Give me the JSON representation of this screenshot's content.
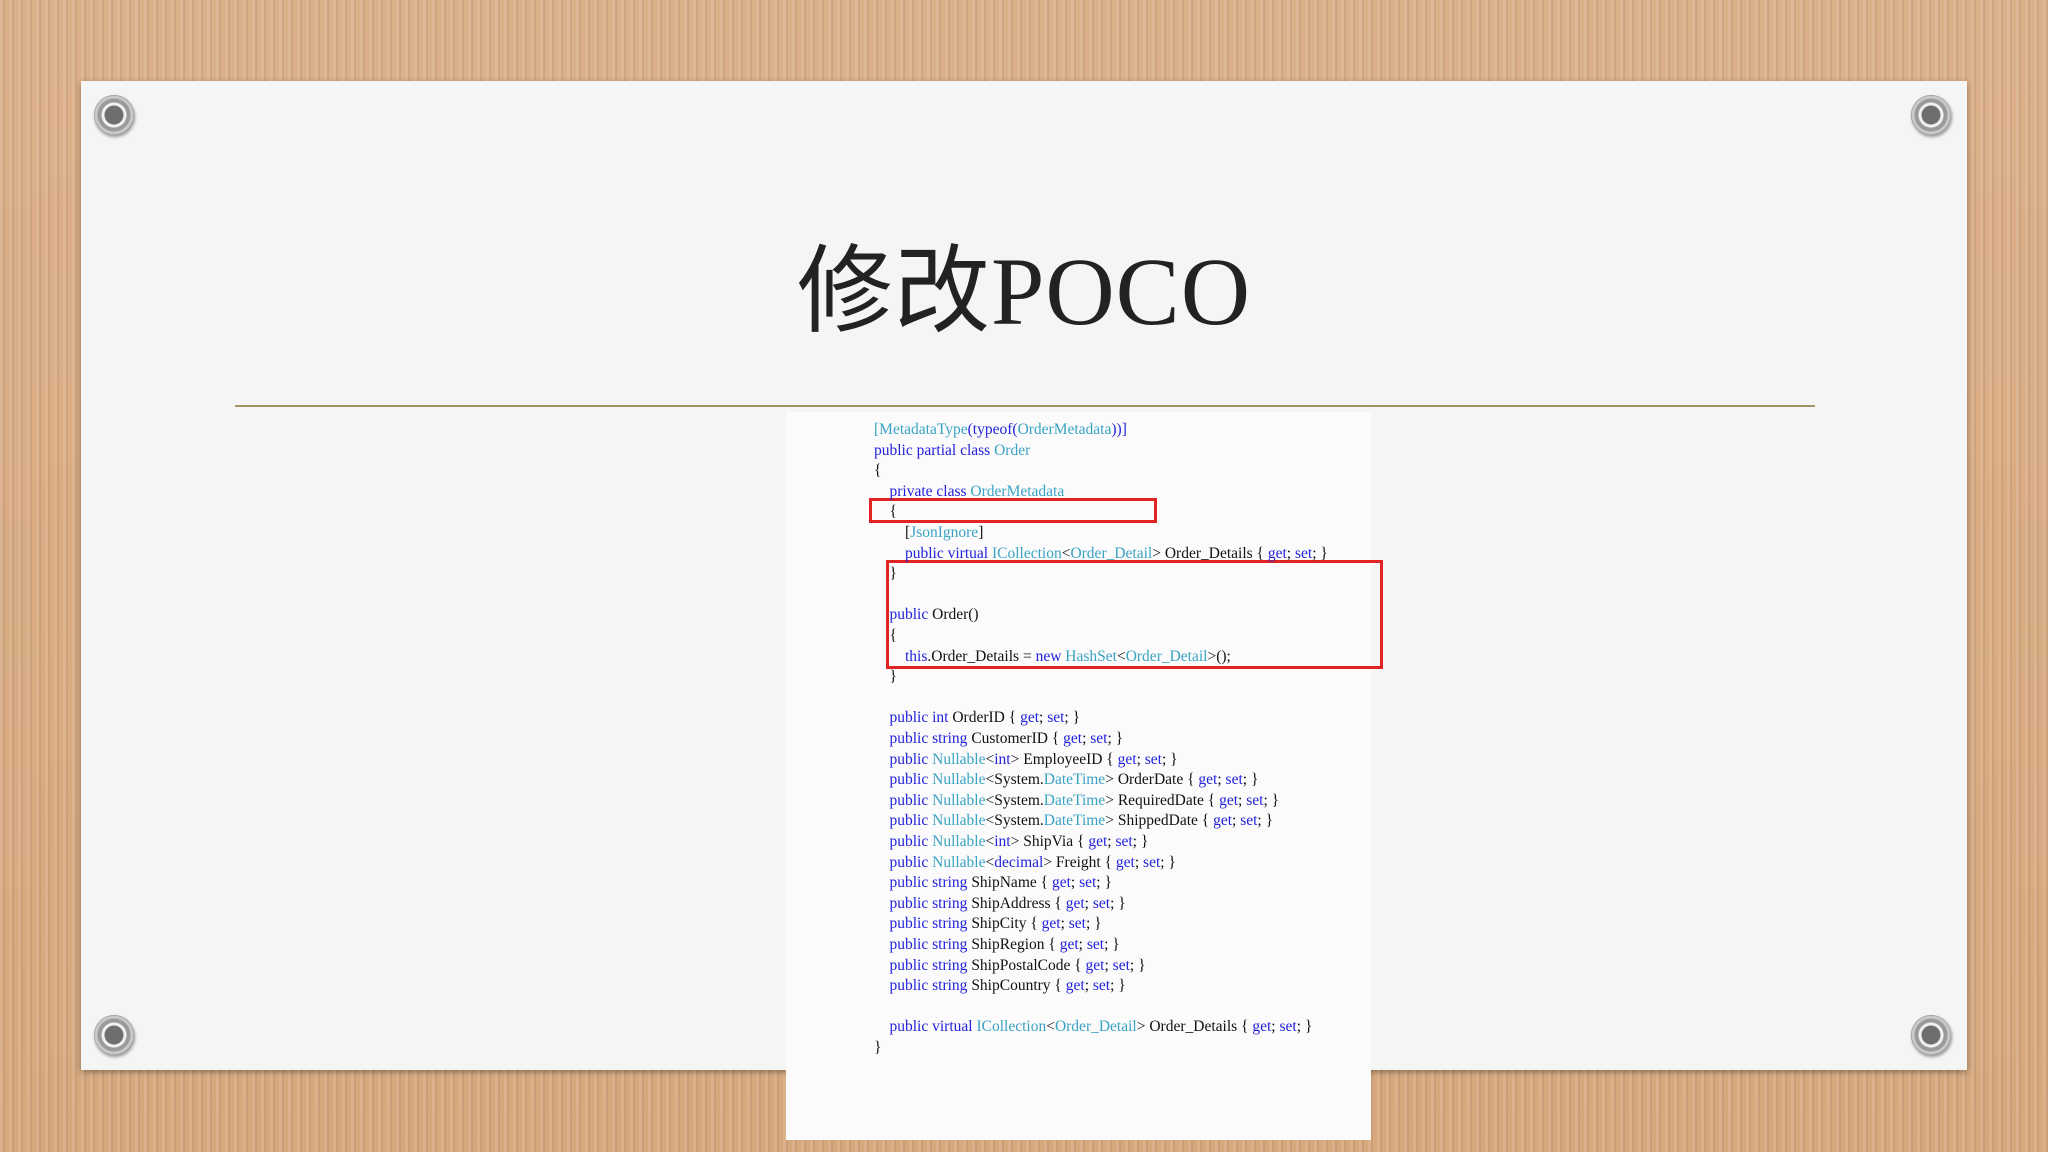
{
  "slide": {
    "title": "修改POCO"
  },
  "code": {
    "attribute": "[MetadataType(typeof(OrderMetadata))]",
    "lines": [
      [
        {
          "t": "[",
          "c": "ty"
        },
        {
          "t": "MetadataType",
          "c": "ty"
        },
        {
          "t": "(",
          "c": "kw"
        },
        {
          "t": "typeof",
          "c": "kw"
        },
        {
          "t": "(",
          "c": "kw"
        },
        {
          "t": "OrderMetadata",
          "c": "ty"
        },
        {
          "t": "))]",
          "c": "kw"
        }
      ],
      [
        {
          "t": "public partial class ",
          "c": "kw"
        },
        {
          "t": "Order",
          "c": "ty"
        }
      ],
      [
        {
          "t": "{",
          "c": ""
        }
      ],
      [
        {
          "t": "    private class ",
          "c": "kw"
        },
        {
          "t": "OrderMetadata",
          "c": "ty"
        }
      ],
      [
        {
          "t": "    {",
          "c": ""
        }
      ],
      [
        {
          "t": "        [",
          "c": ""
        },
        {
          "t": "JsonIgnore",
          "c": "ty"
        },
        {
          "t": "]",
          "c": ""
        }
      ],
      [
        {
          "t": "        public virtual ",
          "c": "kw"
        },
        {
          "t": "ICollection",
          "c": "ty"
        },
        {
          "t": "<",
          "c": ""
        },
        {
          "t": "Order_Detail",
          "c": "ty"
        },
        {
          "t": "> Order_Details { ",
          "c": ""
        },
        {
          "t": "get",
          "c": "kw"
        },
        {
          "t": "; ",
          "c": ""
        },
        {
          "t": "set",
          "c": "kw"
        },
        {
          "t": "; }",
          "c": ""
        }
      ],
      [
        {
          "t": "    }",
          "c": ""
        }
      ],
      [
        {
          "t": "",
          "c": ""
        }
      ],
      [
        {
          "t": "    public ",
          "c": "kw"
        },
        {
          "t": "Order()",
          "c": ""
        }
      ],
      [
        {
          "t": "    {",
          "c": ""
        }
      ],
      [
        {
          "t": "        this",
          "c": "kw"
        },
        {
          "t": ".Order_Details = ",
          "c": ""
        },
        {
          "t": "new ",
          "c": "kw"
        },
        {
          "t": "HashSet",
          "c": "ty"
        },
        {
          "t": "<",
          "c": ""
        },
        {
          "t": "Order_Detail",
          "c": "ty"
        },
        {
          "t": ">();",
          "c": ""
        }
      ],
      [
        {
          "t": "    }",
          "c": ""
        }
      ],
      [
        {
          "t": "",
          "c": ""
        }
      ],
      [
        {
          "t": "    public int ",
          "c": "kw"
        },
        {
          "t": "OrderID { ",
          "c": ""
        },
        {
          "t": "get",
          "c": "kw"
        },
        {
          "t": "; ",
          "c": ""
        },
        {
          "t": "set",
          "c": "kw"
        },
        {
          "t": "; }",
          "c": ""
        }
      ],
      [
        {
          "t": "    public string ",
          "c": "kw"
        },
        {
          "t": "CustomerID { ",
          "c": ""
        },
        {
          "t": "get",
          "c": "kw"
        },
        {
          "t": "; ",
          "c": ""
        },
        {
          "t": "set",
          "c": "kw"
        },
        {
          "t": "; }",
          "c": ""
        }
      ],
      [
        {
          "t": "    public ",
          "c": "kw"
        },
        {
          "t": "Nullable",
          "c": "ty"
        },
        {
          "t": "<",
          "c": ""
        },
        {
          "t": "int",
          "c": "kw"
        },
        {
          "t": "> EmployeeID { ",
          "c": ""
        },
        {
          "t": "get",
          "c": "kw"
        },
        {
          "t": "; ",
          "c": ""
        },
        {
          "t": "set",
          "c": "kw"
        },
        {
          "t": "; }",
          "c": ""
        }
      ],
      [
        {
          "t": "    public ",
          "c": "kw"
        },
        {
          "t": "Nullable",
          "c": "ty"
        },
        {
          "t": "<System.",
          "c": ""
        },
        {
          "t": "DateTime",
          "c": "ty"
        },
        {
          "t": "> OrderDate { ",
          "c": ""
        },
        {
          "t": "get",
          "c": "kw"
        },
        {
          "t": "; ",
          "c": ""
        },
        {
          "t": "set",
          "c": "kw"
        },
        {
          "t": "; }",
          "c": ""
        }
      ],
      [
        {
          "t": "    public ",
          "c": "kw"
        },
        {
          "t": "Nullable",
          "c": "ty"
        },
        {
          "t": "<System.",
          "c": ""
        },
        {
          "t": "DateTime",
          "c": "ty"
        },
        {
          "t": "> RequiredDate { ",
          "c": ""
        },
        {
          "t": "get",
          "c": "kw"
        },
        {
          "t": "; ",
          "c": ""
        },
        {
          "t": "set",
          "c": "kw"
        },
        {
          "t": "; }",
          "c": ""
        }
      ],
      [
        {
          "t": "    public ",
          "c": "kw"
        },
        {
          "t": "Nullable",
          "c": "ty"
        },
        {
          "t": "<System.",
          "c": ""
        },
        {
          "t": "DateTime",
          "c": "ty"
        },
        {
          "t": "> ShippedDate { ",
          "c": ""
        },
        {
          "t": "get",
          "c": "kw"
        },
        {
          "t": "; ",
          "c": ""
        },
        {
          "t": "set",
          "c": "kw"
        },
        {
          "t": "; }",
          "c": ""
        }
      ],
      [
        {
          "t": "    public ",
          "c": "kw"
        },
        {
          "t": "Nullable",
          "c": "ty"
        },
        {
          "t": "<",
          "c": ""
        },
        {
          "t": "int",
          "c": "kw"
        },
        {
          "t": "> ShipVia { ",
          "c": ""
        },
        {
          "t": "get",
          "c": "kw"
        },
        {
          "t": "; ",
          "c": ""
        },
        {
          "t": "set",
          "c": "kw"
        },
        {
          "t": "; }",
          "c": ""
        }
      ],
      [
        {
          "t": "    public ",
          "c": "kw"
        },
        {
          "t": "Nullable",
          "c": "ty"
        },
        {
          "t": "<",
          "c": ""
        },
        {
          "t": "decimal",
          "c": "kw"
        },
        {
          "t": "> Freight { ",
          "c": ""
        },
        {
          "t": "get",
          "c": "kw"
        },
        {
          "t": "; ",
          "c": ""
        },
        {
          "t": "set",
          "c": "kw"
        },
        {
          "t": "; }",
          "c": ""
        }
      ],
      [
        {
          "t": "    public string ",
          "c": "kw"
        },
        {
          "t": "ShipName { ",
          "c": ""
        },
        {
          "t": "get",
          "c": "kw"
        },
        {
          "t": "; ",
          "c": ""
        },
        {
          "t": "set",
          "c": "kw"
        },
        {
          "t": "; }",
          "c": ""
        }
      ],
      [
        {
          "t": "    public string ",
          "c": "kw"
        },
        {
          "t": "ShipAddress { ",
          "c": ""
        },
        {
          "t": "get",
          "c": "kw"
        },
        {
          "t": "; ",
          "c": ""
        },
        {
          "t": "set",
          "c": "kw"
        },
        {
          "t": "; }",
          "c": ""
        }
      ],
      [
        {
          "t": "    public string ",
          "c": "kw"
        },
        {
          "t": "ShipCity { ",
          "c": ""
        },
        {
          "t": "get",
          "c": "kw"
        },
        {
          "t": "; ",
          "c": ""
        },
        {
          "t": "set",
          "c": "kw"
        },
        {
          "t": "; }",
          "c": ""
        }
      ],
      [
        {
          "t": "    public string ",
          "c": "kw"
        },
        {
          "t": "ShipRegion { ",
          "c": ""
        },
        {
          "t": "get",
          "c": "kw"
        },
        {
          "t": "; ",
          "c": ""
        },
        {
          "t": "set",
          "c": "kw"
        },
        {
          "t": "; }",
          "c": ""
        }
      ],
      [
        {
          "t": "    public string ",
          "c": "kw"
        },
        {
          "t": "ShipPostalCode { ",
          "c": ""
        },
        {
          "t": "get",
          "c": "kw"
        },
        {
          "t": "; ",
          "c": ""
        },
        {
          "t": "set",
          "c": "kw"
        },
        {
          "t": "; }",
          "c": ""
        }
      ],
      [
        {
          "t": "    public string ",
          "c": "kw"
        },
        {
          "t": "ShipCountry { ",
          "c": ""
        },
        {
          "t": "get",
          "c": "kw"
        },
        {
          "t": "; ",
          "c": ""
        },
        {
          "t": "set",
          "c": "kw"
        },
        {
          "t": "; }",
          "c": ""
        }
      ],
      [
        {
          "t": "",
          "c": ""
        }
      ],
      [
        {
          "t": "    public virtual ",
          "c": "kw"
        },
        {
          "t": "ICollection",
          "c": "ty"
        },
        {
          "t": "<",
          "c": ""
        },
        {
          "t": "Order_Detail",
          "c": "ty"
        },
        {
          "t": "> Order_Details { ",
          "c": ""
        },
        {
          "t": "get",
          "c": "kw"
        },
        {
          "t": "; ",
          "c": ""
        },
        {
          "t": "set",
          "c": "kw"
        },
        {
          "t": "; }",
          "c": ""
        }
      ],
      [
        {
          "t": "}",
          "c": ""
        }
      ]
    ]
  },
  "colors": {
    "keyword": "#2222dd",
    "type": "#3aa3c4",
    "highlight": "#e02424"
  }
}
